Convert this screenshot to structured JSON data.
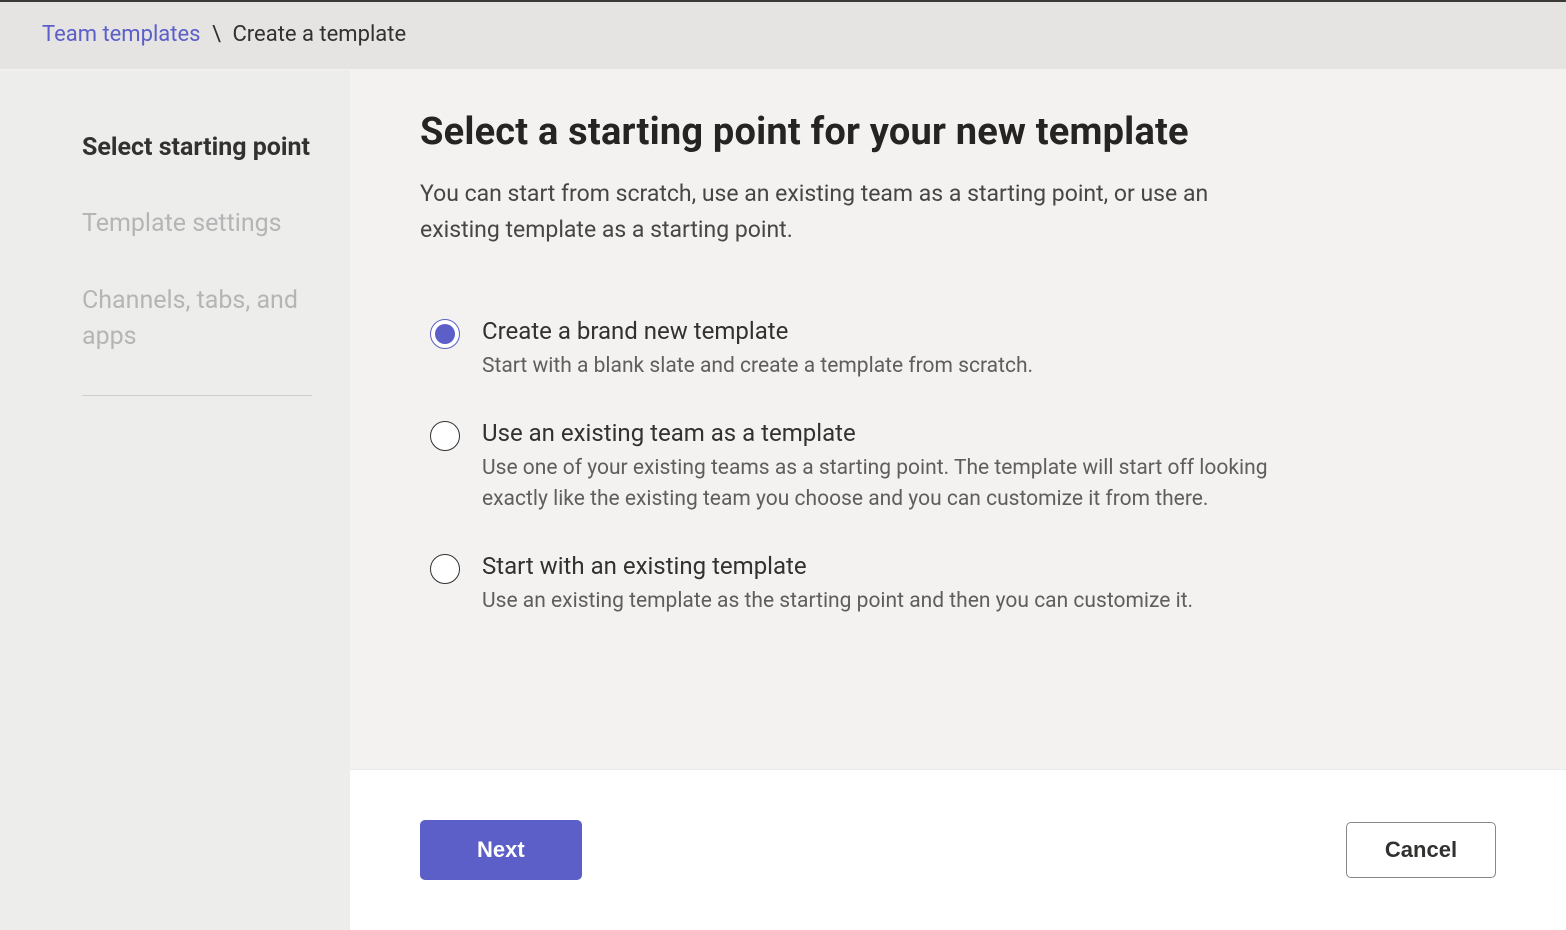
{
  "breadcrumb": {
    "parent": "Team templates",
    "separator": "\\",
    "current": "Create a template"
  },
  "sidebar": {
    "steps": [
      {
        "label": "Select starting point",
        "active": true
      },
      {
        "label": "Template settings",
        "active": false
      },
      {
        "label": "Channels, tabs, and apps",
        "active": false
      }
    ]
  },
  "header": {
    "title": "Select a starting point for your new template",
    "description": "You can start from scratch, use an existing team as a starting point, or use an existing template as a starting point."
  },
  "options": [
    {
      "title": "Create a brand new template",
      "description": "Start with a blank slate and create a template from scratch.",
      "selected": true
    },
    {
      "title": "Use an existing team as a template",
      "description": "Use one of your existing teams as a starting point. The template will start off looking exactly like the existing team you choose and you can customize it from there.",
      "selected": false
    },
    {
      "title": "Start with an existing template",
      "description": "Use an existing template as the starting point and then you can customize it.",
      "selected": false
    }
  ],
  "footer": {
    "next": "Next",
    "cancel": "Cancel"
  }
}
